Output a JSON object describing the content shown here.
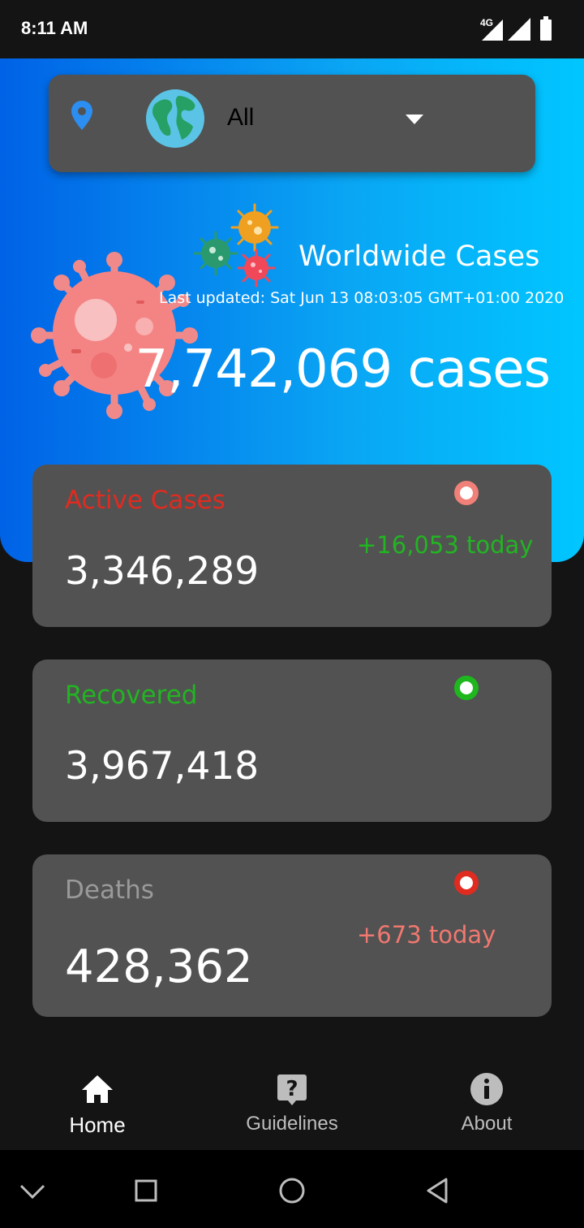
{
  "status_bar": {
    "time": "8:11 AM",
    "network": "4G"
  },
  "location_selector": {
    "value": "All"
  },
  "worldwide": {
    "title": "Worldwide Cases",
    "last_updated": "Last updated: Sat Jun 13 08:03:05 GMT+01:00 2020",
    "total_cases": "7,742,069 cases"
  },
  "cards": [
    {
      "title": "Active Cases",
      "value": "3,346,289",
      "today": "+16,053 today",
      "title_color": "#e02b20",
      "today_color": "#22b422",
      "dot_color": "#f08078"
    },
    {
      "title": "Recovered",
      "value": "3,967,418",
      "today": "",
      "title_color": "#22b422",
      "today_color": "#22b422",
      "dot_color": "#1eb81e"
    },
    {
      "title": "Deaths",
      "value": "428,362",
      "today": "+673 today",
      "title_color": "#9a9a9a",
      "today_color": "#f07870",
      "dot_color": "#e02b20"
    }
  ],
  "bottom_nav": [
    {
      "label": "Home",
      "icon": "home-icon",
      "active": true
    },
    {
      "label": "Guidelines",
      "icon": "help-icon",
      "active": false
    },
    {
      "label": "About",
      "icon": "info-icon",
      "active": false
    }
  ],
  "colors": {
    "hero_start": "#0062e6",
    "hero_end": "#00c6ff",
    "card_bg": "#525252",
    "app_bg": "#141414"
  }
}
